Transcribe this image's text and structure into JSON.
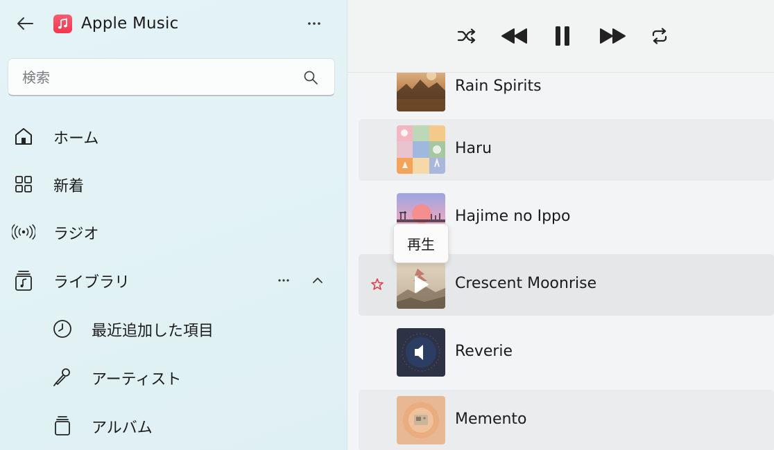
{
  "app": {
    "title": "Apple Music",
    "accent_color": "#f33a52",
    "back_icon": "back-arrow-icon",
    "more_icon": "more-horizontal-icon"
  },
  "search": {
    "placeholder": "検索",
    "value": "",
    "icon": "search-icon"
  },
  "sidebar": {
    "items": [
      {
        "label": "ホーム",
        "icon": "home-icon"
      },
      {
        "label": "新着",
        "icon": "grid-icon"
      },
      {
        "label": "ラジオ",
        "icon": "radio-broadcast-icon"
      },
      {
        "label": "ライブラリ",
        "icon": "library-icon",
        "expanded": true
      }
    ],
    "library_subitems": [
      {
        "label": "最近追加した項目",
        "icon": "clock-icon"
      },
      {
        "label": "アーティスト",
        "icon": "microphone-icon"
      },
      {
        "label": "アルバム",
        "icon": "album-stack-icon"
      }
    ]
  },
  "player": {
    "controls": [
      {
        "name": "shuffle",
        "icon": "shuffle-icon"
      },
      {
        "name": "previous",
        "icon": "previous-icon"
      },
      {
        "name": "pause",
        "icon": "pause-icon"
      },
      {
        "name": "next",
        "icon": "next-icon"
      },
      {
        "name": "repeat",
        "icon": "repeat-icon"
      }
    ]
  },
  "tracks": [
    {
      "title": "Rain Spirits",
      "favorite": false
    },
    {
      "title": "Haru",
      "favorite": false
    },
    {
      "title": "Hajime no Ippo",
      "favorite": false
    },
    {
      "title": "Crescent Moonrise",
      "favorite": true,
      "hovered": true
    },
    {
      "title": "Reverie",
      "favorite": false,
      "now_playing": true
    },
    {
      "title": "Memento",
      "favorite": false
    }
  ],
  "tooltip": {
    "text": "再生"
  }
}
